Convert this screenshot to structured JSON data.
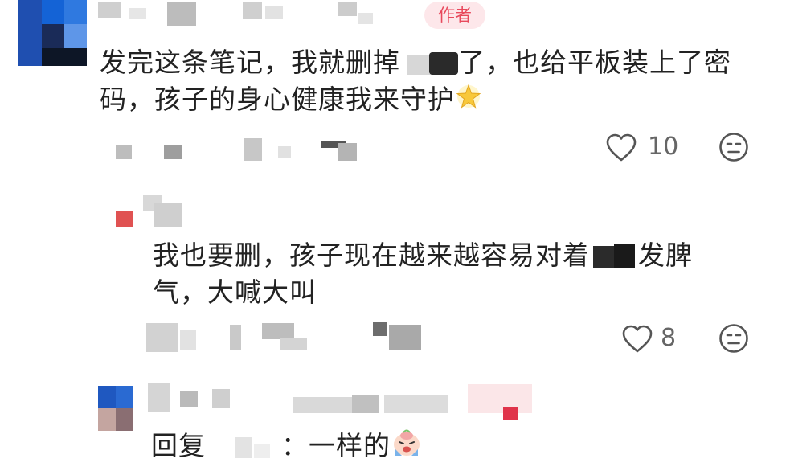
{
  "comment": {
    "badge": "作者",
    "line1": "发完这条笔记，我就删掉",
    "line1_after": "了，也给平板装上了密",
    "line2": "码，孩子的身心健康我来守护",
    "emoji": "sparkle-star",
    "likes": "10"
  },
  "reply1": {
    "line1": "我也要删，孩子现在越来越容易对着",
    "line1_after": "发脾",
    "line2": "气，大喊大叫",
    "likes": "8"
  },
  "reply2": {
    "prefix": "回复",
    "sep": "：",
    "text": "一样的",
    "emoji": "crying-face"
  },
  "colors": {
    "accent": "#e8495c",
    "badge_bg": "#fde7ea",
    "avatar_blue": "#1560c8"
  }
}
